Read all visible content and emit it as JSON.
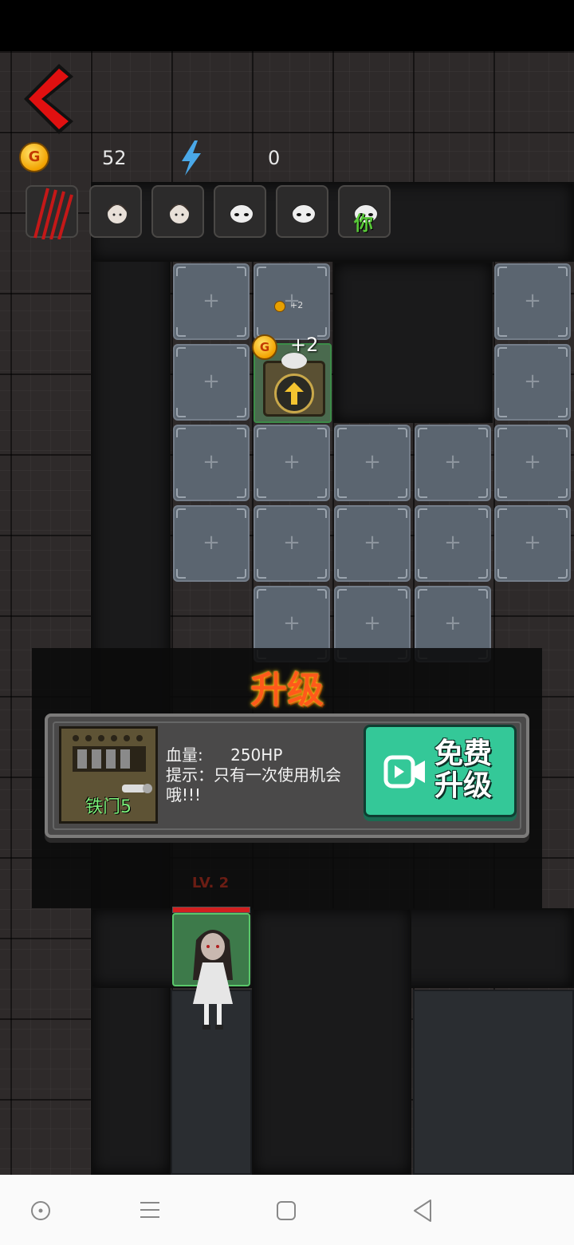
{
  "hud": {
    "coin_label": "G",
    "coins": "52",
    "energy": "0",
    "energy_icon": "lightning-icon"
  },
  "characters": [
    {
      "name": "claw-slot",
      "icon": "claw-icon"
    },
    {
      "name": "girl-1",
      "icon": "girl-face-icon"
    },
    {
      "name": "girl-2",
      "icon": "girl-face-icon"
    },
    {
      "name": "ghost-1",
      "icon": "ghost-face-icon"
    },
    {
      "name": "ghost-2",
      "icon": "ghost-face-icon"
    },
    {
      "name": "ghost-you",
      "icon": "ghost-face-icon",
      "badge": "你"
    }
  ],
  "board": {
    "plus": "+",
    "small_reward": "+2",
    "reward": "+2"
  },
  "popup": {
    "title": "升级",
    "item_name": "铁门5",
    "hp_label": "血量:",
    "hp_value": "250HP",
    "hint": "提示：只有一次使用机会哦!!!",
    "free_upgrade_line1": "免费",
    "free_upgrade_line2": "升级"
  },
  "player": {
    "level": "LV. 2",
    "hp_fraction": 1.0
  },
  "colors": {
    "accent_green": "#34c898",
    "title_orange": "#ff5a1a",
    "back_red": "#e01010"
  }
}
